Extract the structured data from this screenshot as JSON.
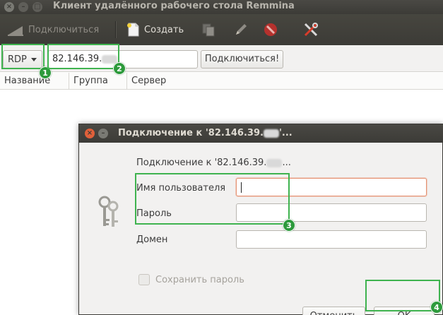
{
  "window": {
    "title": "Клиент удалённого рабочего стола Remmina"
  },
  "toolbar": {
    "connect_label": "Подключиться",
    "create_label": "Создать"
  },
  "connbar": {
    "protocol_value": "RDP",
    "server_value": "82.146.39.",
    "connect_button_label": "Подключиться!"
  },
  "columns": [
    "Название",
    "Группа",
    "Сервер"
  ],
  "dialog": {
    "title": "Подключение к '82.146.39.",
    "title_suffix": "'...",
    "heading": "Подключение к '82.146.39.",
    "heading_suffix": "...",
    "username_label": "Имя пользователя",
    "username_value": "",
    "password_label": "Пароль",
    "password_value": "",
    "domain_label": "Домен",
    "domain_value": "",
    "save_password_label": "Сохранить пароль",
    "cancel_label": "Отменить",
    "ok_label": "OK"
  },
  "annotations": {
    "badge_1": "1",
    "badge_2": "2",
    "badge_3": "3",
    "badge_4": "4",
    "color": "#3fb34f"
  }
}
